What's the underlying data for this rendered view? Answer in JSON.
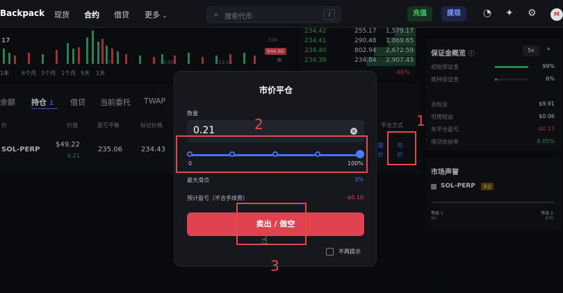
{
  "app": {
    "name": "Backpack"
  },
  "nav": {
    "spot": "现货",
    "futures": "合约",
    "lend": "借贷",
    "more": "更多"
  },
  "search": {
    "placeholder": "搜索代币",
    "shortcut": "/"
  },
  "topbar": {
    "deposit": "充值",
    "withdraw": "提现",
    "avatar": "M"
  },
  "chart": {
    "price_tag": "644.60",
    "axis_labels": [
      "00:00",
      "12:00"
    ],
    "vol_label": "50K",
    "left_label": "17",
    "mid_label": "7",
    "ranges": [
      "1年",
      "6个月",
      "3个月",
      "1个月",
      "5天",
      "1天"
    ]
  },
  "orderbook": {
    "rows": [
      {
        "price": "234.42",
        "size": "255.17",
        "total": "1,579.17",
        "bar": 0.18
      },
      {
        "price": "234.41",
        "size": "290.48",
        "total": "1,869.65",
        "bar": 0.24
      },
      {
        "price": "234.40",
        "size": "802.94",
        "total": "2,672.59",
        "bar": 0.36
      },
      {
        "price": "234.39",
        "size": "234.84",
        "total": "2,907.43",
        "bar": 0.42
      }
    ],
    "pct": "46%"
  },
  "tabs": {
    "balance": "余额",
    "positions": "持仓",
    "positions_count": "1",
    "borrow": "借贷",
    "open_orders": "当前委托",
    "twap": "TWAP"
  },
  "table": {
    "headers": {
      "asset": "价",
      "value": "价值",
      "breakeven": "盈亏平衡",
      "mark": "标记价格",
      "close_method": "平仓方式"
    },
    "row": {
      "symbol": "SOL-PERP",
      "value": "$49.22",
      "qty": "0.21",
      "breakeven": "235.06",
      "mark": "234.43",
      "limit_line1": "限",
      "limit_line2": "价",
      "market_line1": "市",
      "market_line2": "价"
    }
  },
  "margin": {
    "title": "保证金概览",
    "leverage": "5x",
    "initial_label": "初始保证金",
    "initial_value": "99%",
    "maint_label": "维持保证金",
    "maint_value": "6%",
    "equity_label": "总权益",
    "equity_value": "$9.91",
    "available_label": "可用权益",
    "available_value": "$0.06",
    "unrealized_label": "未平仓盈亏",
    "unrealized_value": "-$0.13",
    "borrow_label": "借贷收益率",
    "borrow_value": "6.05%"
  },
  "reputation": {
    "title": "市场声誉",
    "symbol": "SOL-PERP",
    "badge": "黄金",
    "level1": "等级 1",
    "level1_val": "$0",
    "level2": "等级 2",
    "level2_val": "$30"
  },
  "modal": {
    "title": "市价平仓",
    "qty_label": "数量",
    "qty_value": "0.21",
    "slider_min": "0",
    "slider_max": "100%",
    "slider_fraction": 1.0,
    "slippage_label": "最大滑点",
    "slippage_value": "3%",
    "pnl_label": "预计盈亏（不含手续费）",
    "pnl_value": "-$0.10",
    "sell_button": "卖出 / 做空",
    "no_remind": "不再提示"
  },
  "annotations": {
    "n1": "1",
    "n2": "2",
    "n3": "3"
  },
  "colors": {
    "red": "#e0434f",
    "green": "#38b36e",
    "blue": "#4a7bff",
    "annot": "#e24b4b"
  }
}
